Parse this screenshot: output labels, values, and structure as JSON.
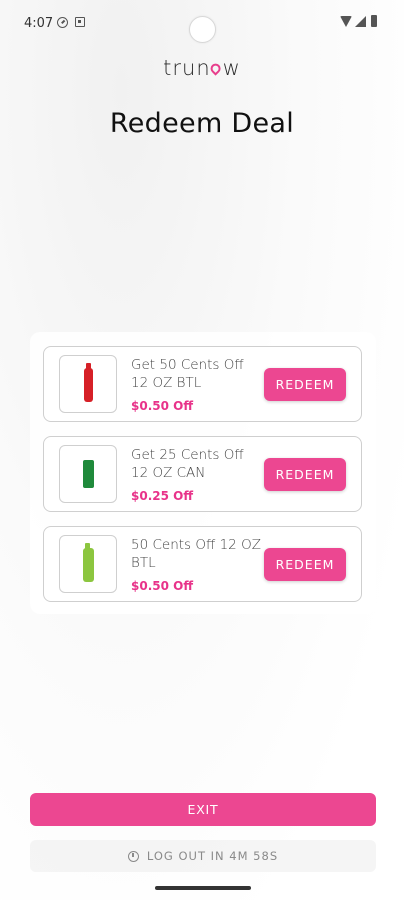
{
  "status_bar": {
    "time": "4:07",
    "icons": [
      "do-not-disturb-icon",
      "accessibility-icon",
      "wifi-icon",
      "signal-icon",
      "battery-icon"
    ]
  },
  "brand": {
    "logo_left": "trun",
    "logo_right": "w",
    "accent_color": "#ec4791"
  },
  "header": {
    "title": "Redeem Deal"
  },
  "deals": [
    {
      "title": "Get 50 Cents Off 12 OZ BTL",
      "discount": "$0.50 Off",
      "button_label": "REDEEM",
      "image": "red-soda-bottle"
    },
    {
      "title": "Get 25 Cents Off 12 OZ CAN",
      "discount": "$0.25 Off",
      "button_label": "REDEEM",
      "image": "green-soda-can"
    },
    {
      "title": "50 Cents Off 12 OZ BTL",
      "discount": "$0.50 Off",
      "button_label": "REDEEM",
      "image": "green-soda-bottle"
    }
  ],
  "footer": {
    "exit_label": "EXIT",
    "logout_text": "LOG OUT IN 4M 58S"
  }
}
